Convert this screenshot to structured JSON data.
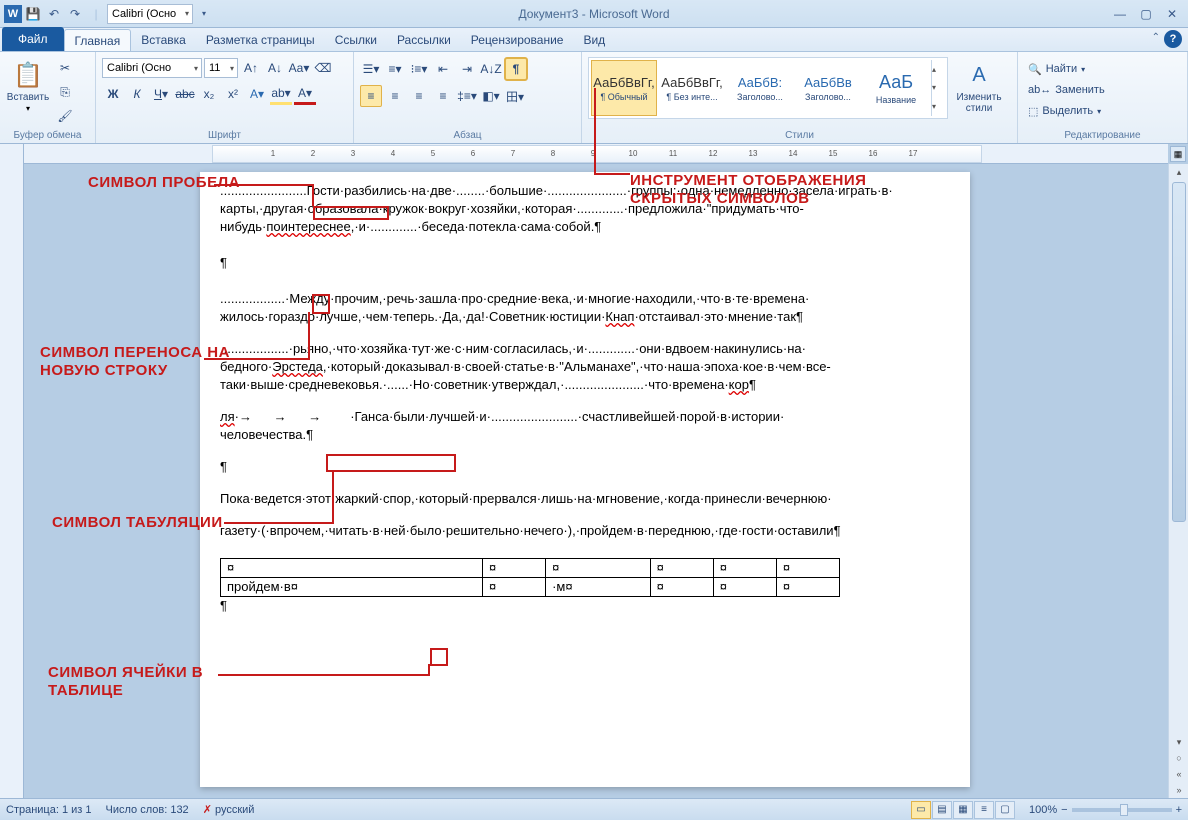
{
  "title": "Документ3 - Microsoft Word",
  "qat": {
    "font_combo": "Calibri (Осно"
  },
  "tabs": {
    "file": "Файл",
    "items": [
      "Главная",
      "Вставка",
      "Разметка страницы",
      "Ссылки",
      "Рассылки",
      "Рецензирование",
      "Вид"
    ],
    "active": 0
  },
  "ribbon": {
    "clipboard": {
      "paste": "Вставить",
      "label": "Буфер обмена"
    },
    "font": {
      "name": "Calibri (Осно",
      "size": "11",
      "label": "Шрифт"
    },
    "paragraph": {
      "label": "Абзац"
    },
    "styles": {
      "label": "Стили",
      "items": [
        {
          "preview": "АаБбВвГг,",
          "name": "¶ Обычный",
          "sel": true
        },
        {
          "preview": "АаБбВвГг,",
          "name": "¶ Без инте..."
        },
        {
          "preview": "АаБбВ:",
          "name": "Заголово...",
          "blue": true
        },
        {
          "preview": "АаБбВв",
          "name": "Заголово...",
          "blue": true
        },
        {
          "preview": "АаБ",
          "name": "Название",
          "blue": true
        }
      ],
      "change": "Изменить\nстили"
    },
    "editing": {
      "find": "Найти",
      "replace": "Заменить",
      "select": "Выделить",
      "label": "Редактирование"
    }
  },
  "ruler": {
    "marks": [
      "",
      "1",
      "2",
      "",
      "1",
      "2",
      "3",
      "4",
      "5",
      "6",
      "7",
      "8",
      "9",
      "10",
      "11",
      "12",
      "13",
      "14",
      "15",
      "16",
      "17",
      ""
    ]
  },
  "doc": {
    "p1": "........................Гости·разбились·на·две·........·большие·......................·группы:·одна·немедленно·засела·играть·в·",
    "p1b": "карты,·другая·образовала·кружок·вокруг·хозяйки,·которая·.............·предложила·\"придумать·что-",
    "p1c": "нибудь·поинтереснее\",·и·.............·беседа·потекла·сама·собой.¶",
    "pilcrow": "¶",
    "p2a": "..................·Между·прочим,·речь·зашла·про·средние·века,·и·многие·находили,·что·в·те·времена·",
    "p2b": "жилось·гораздо·лучше,·чем·теперь.·Да,·да!·Советник·юстиции·Кнап·отстаивал·это·мнение·так¶",
    "p3a": "...................·рьяно,·что·хозяйка·тут·же·с·ним·согласилась,·и·.............·они·вдвоем·накинулись·на·",
    "p3b": "бедного·Эрстеда,·который·доказывал·в·своей·статье·в·\"Альманахе\",·что·наша·эпоха·кое·в·чем·все-",
    "p3c": "таки·выше·средневековья.·......·Но·советник·утверждал,·......................·что·времена·кор¶",
    "p4a": "ля·→      →       →·        ·Ганса·были·лучшей·и·........................·счастливейшей·порой·в·истории·",
    "p4b": "человечества.¶",
    "p5": "¶",
    "p6": "Пока·ведется·этот·жаркий·спор,·который·прервался·лишь·на·мгновение,·когда·принесли·вечернюю·",
    "p7": "газету·(·впрочем,·читать·в·ней·было·решительно·нечего·),·пройдем·в·переднюю,·где·гости·оставили¶",
    "tbl": {
      "r1": [
        "¤",
        "¤",
        "¤",
        "¤",
        "¤",
        "¤"
      ],
      "r2": [
        "пройдем·в¤",
        "¤",
        "·м¤",
        "¤",
        "¤",
        "¤"
      ]
    },
    "p8": "¶"
  },
  "annotations": {
    "space": "СИМВОЛ ПРОБЕЛА",
    "tool": "ИНСТРУМЕНТ ОТОБРАЖЕНИЯ\nСКРЫТЫХ СИМВОЛОВ",
    "newline": "СИМВОЛ ПЕРЕНОСА НА\nНОВУЮ СТРОКУ",
    "tab": "СИМВОЛ ТАБУЛЯЦИИ",
    "cell": "СИМВОЛ ЯЧЕЙКИ В\nТАБЛИЦЕ"
  },
  "status": {
    "page": "Страница: 1 из 1",
    "words": "Число слов: 132",
    "lang": "русский",
    "zoom": "100%"
  }
}
